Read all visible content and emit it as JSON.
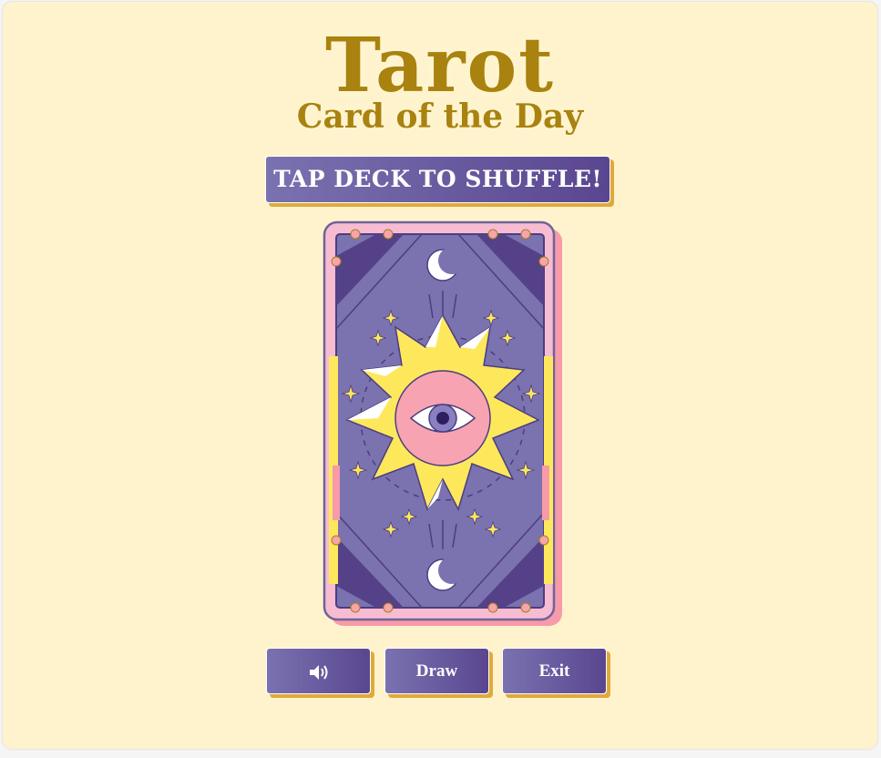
{
  "title": {
    "main": "Tarot",
    "sub": "Card of the Day"
  },
  "banner": {
    "label": "TAP DECK TO SHUFFLE!"
  },
  "deck": {
    "icon": "tarot-card-back-eye-sun"
  },
  "controls": {
    "sound_icon": "speaker-volume-icon",
    "draw_label": "Draw",
    "exit_label": "Exit"
  },
  "colors": {
    "background": "#fef3cd",
    "title_gold": "#a9820f",
    "button_purple_start": "#7a72b0",
    "button_purple_end": "#5a4690",
    "button_shadow": "#e0a93a",
    "card_purple": "#7b72b0",
    "card_pink": "#f7a3b1",
    "card_yellow": "#fde85c"
  }
}
